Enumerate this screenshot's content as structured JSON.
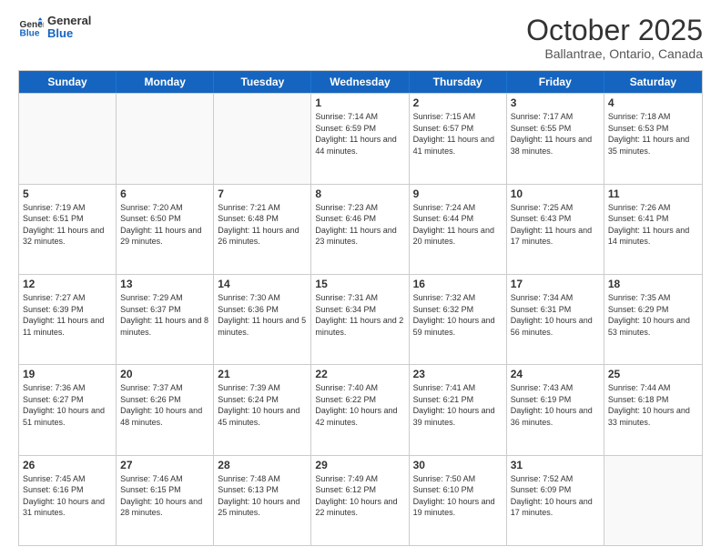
{
  "logo": {
    "line1": "General",
    "line2": "Blue"
  },
  "title": "October 2025",
  "location": "Ballantrae, Ontario, Canada",
  "header_days": [
    "Sunday",
    "Monday",
    "Tuesday",
    "Wednesday",
    "Thursday",
    "Friday",
    "Saturday"
  ],
  "rows": [
    [
      {
        "day": "",
        "empty": true
      },
      {
        "day": "",
        "empty": true
      },
      {
        "day": "",
        "empty": true
      },
      {
        "day": "1",
        "sunrise": "7:14 AM",
        "sunset": "6:59 PM",
        "daylight": "11 hours and 44 minutes."
      },
      {
        "day": "2",
        "sunrise": "7:15 AM",
        "sunset": "6:57 PM",
        "daylight": "11 hours and 41 minutes."
      },
      {
        "day": "3",
        "sunrise": "7:17 AM",
        "sunset": "6:55 PM",
        "daylight": "11 hours and 38 minutes."
      },
      {
        "day": "4",
        "sunrise": "7:18 AM",
        "sunset": "6:53 PM",
        "daylight": "11 hours and 35 minutes."
      }
    ],
    [
      {
        "day": "5",
        "sunrise": "7:19 AM",
        "sunset": "6:51 PM",
        "daylight": "11 hours and 32 minutes."
      },
      {
        "day": "6",
        "sunrise": "7:20 AM",
        "sunset": "6:50 PM",
        "daylight": "11 hours and 29 minutes."
      },
      {
        "day": "7",
        "sunrise": "7:21 AM",
        "sunset": "6:48 PM",
        "daylight": "11 hours and 26 minutes."
      },
      {
        "day": "8",
        "sunrise": "7:23 AM",
        "sunset": "6:46 PM",
        "daylight": "11 hours and 23 minutes."
      },
      {
        "day": "9",
        "sunrise": "7:24 AM",
        "sunset": "6:44 PM",
        "daylight": "11 hours and 20 minutes."
      },
      {
        "day": "10",
        "sunrise": "7:25 AM",
        "sunset": "6:43 PM",
        "daylight": "11 hours and 17 minutes."
      },
      {
        "day": "11",
        "sunrise": "7:26 AM",
        "sunset": "6:41 PM",
        "daylight": "11 hours and 14 minutes."
      }
    ],
    [
      {
        "day": "12",
        "sunrise": "7:27 AM",
        "sunset": "6:39 PM",
        "daylight": "11 hours and 11 minutes."
      },
      {
        "day": "13",
        "sunrise": "7:29 AM",
        "sunset": "6:37 PM",
        "daylight": "11 hours and 8 minutes."
      },
      {
        "day": "14",
        "sunrise": "7:30 AM",
        "sunset": "6:36 PM",
        "daylight": "11 hours and 5 minutes."
      },
      {
        "day": "15",
        "sunrise": "7:31 AM",
        "sunset": "6:34 PM",
        "daylight": "11 hours and 2 minutes."
      },
      {
        "day": "16",
        "sunrise": "7:32 AM",
        "sunset": "6:32 PM",
        "daylight": "10 hours and 59 minutes."
      },
      {
        "day": "17",
        "sunrise": "7:34 AM",
        "sunset": "6:31 PM",
        "daylight": "10 hours and 56 minutes."
      },
      {
        "day": "18",
        "sunrise": "7:35 AM",
        "sunset": "6:29 PM",
        "daylight": "10 hours and 53 minutes."
      }
    ],
    [
      {
        "day": "19",
        "sunrise": "7:36 AM",
        "sunset": "6:27 PM",
        "daylight": "10 hours and 51 minutes."
      },
      {
        "day": "20",
        "sunrise": "7:37 AM",
        "sunset": "6:26 PM",
        "daylight": "10 hours and 48 minutes."
      },
      {
        "day": "21",
        "sunrise": "7:39 AM",
        "sunset": "6:24 PM",
        "daylight": "10 hours and 45 minutes."
      },
      {
        "day": "22",
        "sunrise": "7:40 AM",
        "sunset": "6:22 PM",
        "daylight": "10 hours and 42 minutes."
      },
      {
        "day": "23",
        "sunrise": "7:41 AM",
        "sunset": "6:21 PM",
        "daylight": "10 hours and 39 minutes."
      },
      {
        "day": "24",
        "sunrise": "7:43 AM",
        "sunset": "6:19 PM",
        "daylight": "10 hours and 36 minutes."
      },
      {
        "day": "25",
        "sunrise": "7:44 AM",
        "sunset": "6:18 PM",
        "daylight": "10 hours and 33 minutes."
      }
    ],
    [
      {
        "day": "26",
        "sunrise": "7:45 AM",
        "sunset": "6:16 PM",
        "daylight": "10 hours and 31 minutes."
      },
      {
        "day": "27",
        "sunrise": "7:46 AM",
        "sunset": "6:15 PM",
        "daylight": "10 hours and 28 minutes."
      },
      {
        "day": "28",
        "sunrise": "7:48 AM",
        "sunset": "6:13 PM",
        "daylight": "10 hours and 25 minutes."
      },
      {
        "day": "29",
        "sunrise": "7:49 AM",
        "sunset": "6:12 PM",
        "daylight": "10 hours and 22 minutes."
      },
      {
        "day": "30",
        "sunrise": "7:50 AM",
        "sunset": "6:10 PM",
        "daylight": "10 hours and 19 minutes."
      },
      {
        "day": "31",
        "sunrise": "7:52 AM",
        "sunset": "6:09 PM",
        "daylight": "10 hours and 17 minutes."
      },
      {
        "day": "",
        "empty": true
      }
    ]
  ]
}
